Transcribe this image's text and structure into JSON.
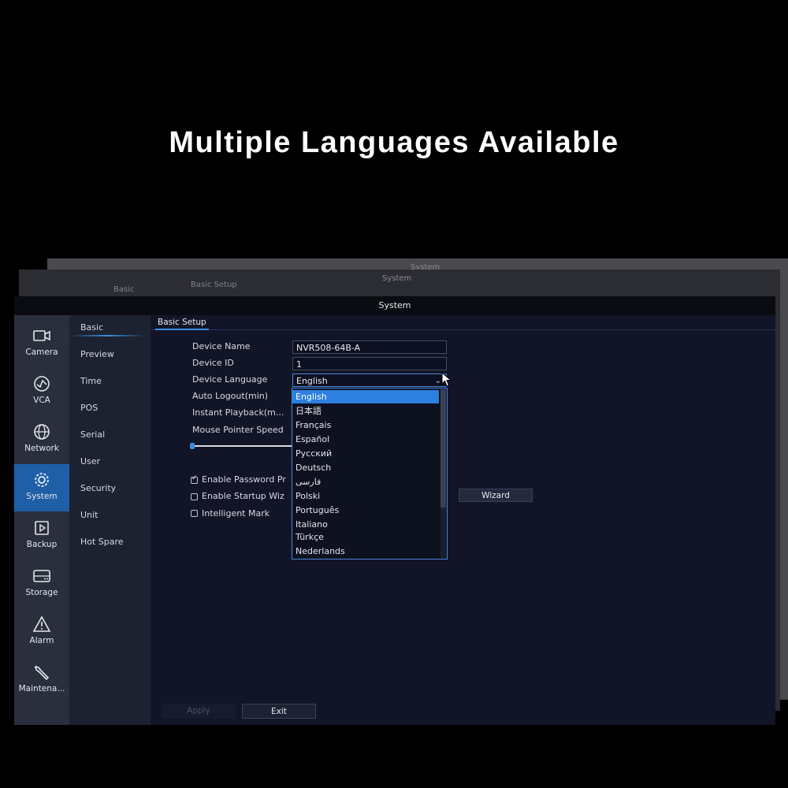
{
  "headline": "Multiple Languages Available",
  "ghost_windows": {
    "back_title": "System",
    "mid_title": "System",
    "mid_tab": "Basic Setup",
    "mid_nav": "Basic",
    "mid_nav2": "Basic Setup"
  },
  "window": {
    "title": "System"
  },
  "left_nav": [
    {
      "label": "Camera",
      "icon": "camera-icon"
    },
    {
      "label": "VCA",
      "icon": "vca-icon"
    },
    {
      "label": "Network",
      "icon": "globe-icon"
    },
    {
      "label": "System",
      "icon": "gear-icon",
      "active": true
    },
    {
      "label": "Backup",
      "icon": "backup-icon"
    },
    {
      "label": "Storage",
      "icon": "storage-icon"
    },
    {
      "label": "Alarm",
      "icon": "alarm-icon"
    },
    {
      "label": "Maintena...",
      "icon": "wrench-icon"
    }
  ],
  "sub_nav": [
    "Basic",
    "Preview",
    "Time",
    "POS",
    "Serial",
    "User",
    "Security",
    "Unit",
    "Hot Spare"
  ],
  "tab": "Basic Setup",
  "form": {
    "device_name_label": "Device Name",
    "device_name_value": "NVR508-64B-A",
    "device_id_label": "Device ID",
    "device_id_value": "1",
    "device_language_label": "Device Language",
    "device_language_value": "English",
    "auto_logout_label": "Auto Logout(min)",
    "instant_playback_label": "Instant Playback(m...",
    "mouse_pointer_label": "Mouse Pointer Speed",
    "enable_password_label": "Enable Password Pr",
    "enable_password_checked": true,
    "enable_startup_label": "Enable Startup Wiz",
    "intelligent_mark_label": "Intelligent Mark",
    "wizard_button": "Wizard"
  },
  "language_options": [
    "English",
    "日本語",
    "Français",
    "Español",
    "Русский",
    "Deutsch",
    "فارسی",
    "Polski",
    "Português",
    "Italiano",
    "Türkçe",
    "Nederlands"
  ],
  "buttons": {
    "apply": "Apply",
    "exit": "Exit"
  },
  "colors": {
    "accent": "#2d7fe0",
    "active_nav": "#1f5fa8",
    "window_bg": "#12172a"
  }
}
